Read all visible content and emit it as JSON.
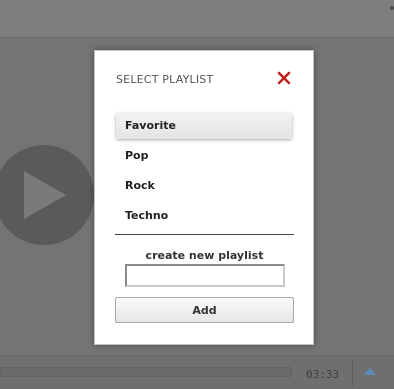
{
  "modal": {
    "title": "SELECT PLAYLIST",
    "close_icon": "close-x-icon",
    "playlists": [
      {
        "label": "Favorite",
        "selected": true
      },
      {
        "label": "Pop",
        "selected": false
      },
      {
        "label": "Rock",
        "selected": false
      },
      {
        "label": "Techno",
        "selected": false
      }
    ],
    "create_label": "create new playlist",
    "new_playlist_value": "",
    "add_label": "Add"
  },
  "player": {
    "time": "03:33",
    "play_icon": "play-icon",
    "up_icon": "triangle-up-icon"
  },
  "colors": {
    "close_red": "#cc1f1f",
    "overlay": "#747474",
    "up_arrow": "#5b8fc0"
  }
}
